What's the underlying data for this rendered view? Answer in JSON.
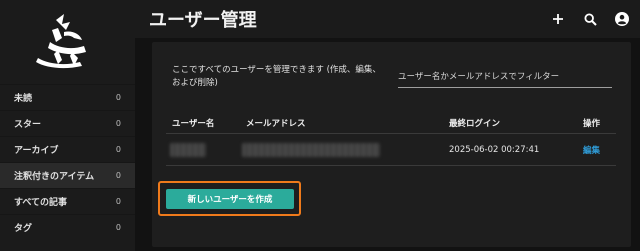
{
  "header": {
    "title": "ユーザー管理",
    "icons": [
      "plus-icon",
      "search-icon",
      "account-circle-icon"
    ]
  },
  "sidebar": {
    "logo": "logo",
    "items": [
      {
        "label": "未読",
        "count": "0"
      },
      {
        "label": "スター",
        "count": "0"
      },
      {
        "label": "アーカイブ",
        "count": "0"
      },
      {
        "label": "注釈付きのアイテム",
        "count": "0",
        "active": true
      },
      {
        "label": "すべての記事",
        "count": "0"
      },
      {
        "label": "タグ",
        "count": "0"
      }
    ]
  },
  "main": {
    "description": "ここですべてのユーザーを管理できます (作成、編集、および削除)",
    "filter_placeholder": "ユーザー名かメールアドレスでフィルター",
    "table": {
      "headers": {
        "username": "ユーザー名",
        "email": "メールアドレス",
        "last_login": "最終ログイン",
        "actions": "操作"
      },
      "rows": [
        {
          "last_login": "2025-06-02 00:27:41",
          "action": "編集"
        }
      ]
    },
    "create_button": "新しいユーザーを作成"
  },
  "colors": {
    "accent": "#2bab9b",
    "link": "#2f9bd6",
    "highlight_border": "#ef7a1b"
  }
}
